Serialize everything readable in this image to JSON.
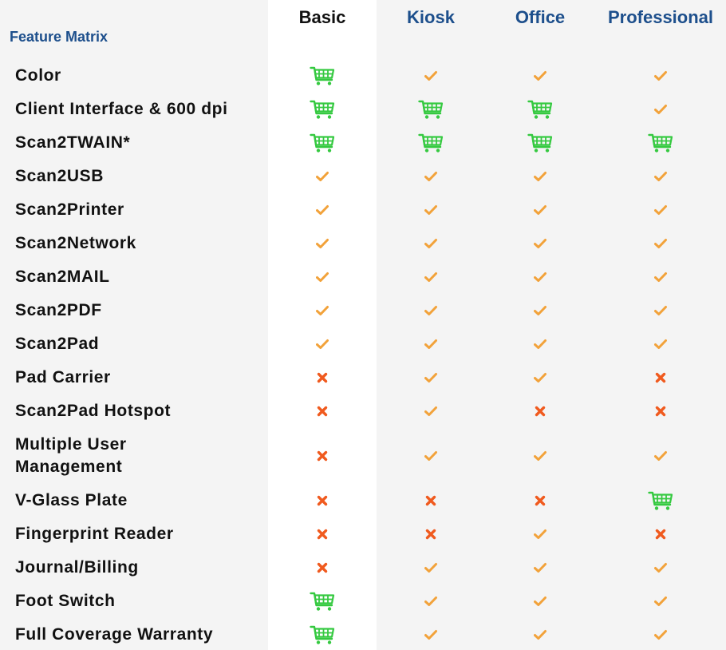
{
  "title": "Feature Matrix",
  "columns": [
    "Basic",
    "Kiosk",
    "Office",
    "Professional"
  ],
  "icons": {
    "check": {
      "name": "check-icon",
      "color": "#f2a23a"
    },
    "cross": {
      "name": "cross-icon",
      "color": "#f05a1e"
    },
    "cart": {
      "name": "cart-icon",
      "color": "#35c940"
    }
  },
  "rows": [
    {
      "label": "Color",
      "values": [
        "cart",
        "check",
        "check",
        "check"
      ]
    },
    {
      "label": "Client Interface & 600 dpi",
      "values": [
        "cart",
        "cart",
        "cart",
        "check"
      ]
    },
    {
      "label": "Scan2TWAIN*",
      "values": [
        "cart",
        "cart",
        "cart",
        "cart"
      ]
    },
    {
      "label": "Scan2USB",
      "values": [
        "check",
        "check",
        "check",
        "check"
      ]
    },
    {
      "label": "Scan2Printer",
      "values": [
        "check",
        "check",
        "check",
        "check"
      ]
    },
    {
      "label": "Scan2Network",
      "values": [
        "check",
        "check",
        "check",
        "check"
      ]
    },
    {
      "label": "Scan2MAIL",
      "values": [
        "check",
        "check",
        "check",
        "check"
      ]
    },
    {
      "label": "Scan2PDF",
      "values": [
        "check",
        "check",
        "check",
        "check"
      ]
    },
    {
      "label": "Scan2Pad",
      "values": [
        "check",
        "check",
        "check",
        "check"
      ]
    },
    {
      "label": "Pad Carrier",
      "values": [
        "cross",
        "check",
        "check",
        "cross"
      ]
    },
    {
      "label": "Scan2Pad Hotspot",
      "values": [
        "cross",
        "check",
        "cross",
        "cross"
      ]
    },
    {
      "label": "Multiple User\nManagement",
      "values": [
        "cross",
        "check",
        "check",
        "check"
      ]
    },
    {
      "label": "V-Glass Plate",
      "values": [
        "cross",
        "cross",
        "cross",
        "cart"
      ]
    },
    {
      "label": "Fingerprint Reader",
      "values": [
        "cross",
        "cross",
        "check",
        "cross"
      ]
    },
    {
      "label": "Journal/Billing",
      "values": [
        "cross",
        "check",
        "check",
        "check"
      ]
    },
    {
      "label": "Foot Switch",
      "values": [
        "cart",
        "check",
        "check",
        "check"
      ]
    },
    {
      "label": "Full Coverage Warranty",
      "values": [
        "cart",
        "check",
        "check",
        "check"
      ]
    }
  ]
}
